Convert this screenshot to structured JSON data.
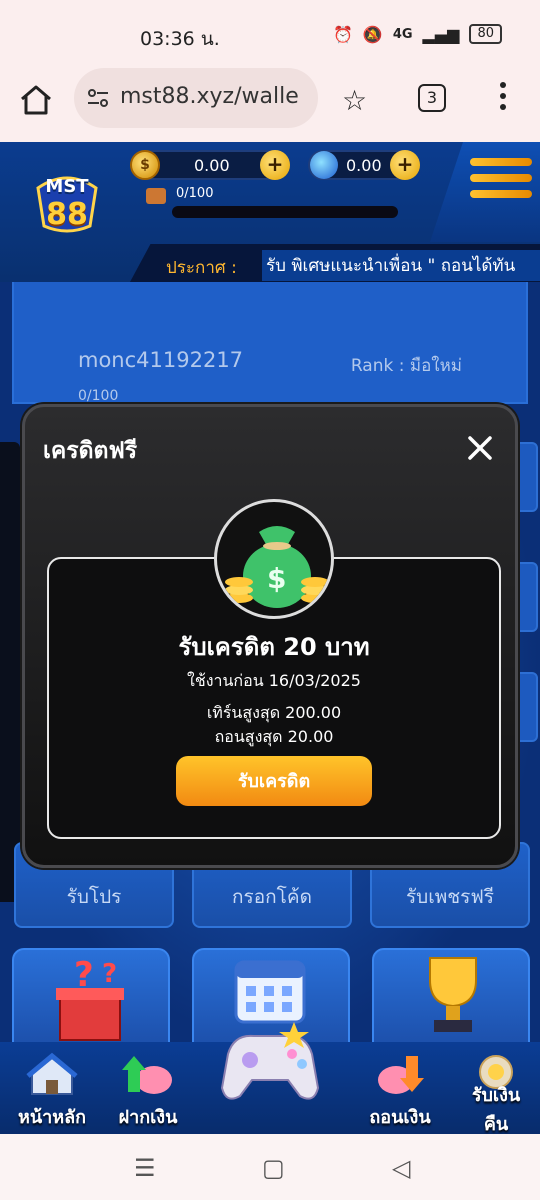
{
  "status_bar": {
    "time": "03:36 น.",
    "battery": "80",
    "network": "4G"
  },
  "browser": {
    "url": "mst88.xyz/walle",
    "tab_count": "3"
  },
  "header": {
    "logo_line1": "MST",
    "logo_line2": "88",
    "coin_balance": "0.00",
    "gem_balance": "0.00",
    "level_progress": "0/100",
    "announcement_label": "ประกาศ :",
    "announcement_text": "รับ พิเศษแนะนำเพื่อน \" ถอนได้ทัน"
  },
  "profile": {
    "username": "monc41192217",
    "rank": "Rank : มือใหม่",
    "xp": "0/100"
  },
  "features": [
    {
      "label": "รับโปร"
    },
    {
      "label": "กรอกโค้ด"
    },
    {
      "label": "รับเพชรฟรี"
    }
  ],
  "bottom_nav": [
    {
      "label": "หน้าหลัก"
    },
    {
      "label": "ฝากเงิน"
    },
    {
      "label": "ถอนเงิน"
    },
    {
      "label": "รับเงิน"
    },
    {
      "label": "คืน"
    }
  ],
  "modal": {
    "title": "เครดิตฟรี",
    "credit_title": "รับเครดิต 20 บาท",
    "expiry": "ใช้งานก่อน 16/03/2025",
    "max_turnover": "เทิร์นสูงสุด 200.00",
    "max_withdraw": "ถอนสูงสุด 20.00",
    "claim_button": "รับเครดิต"
  },
  "colors": {
    "accent_orange": "#f28a12",
    "header_blue": "#0b3c8f",
    "modal_bg": "#111111"
  }
}
